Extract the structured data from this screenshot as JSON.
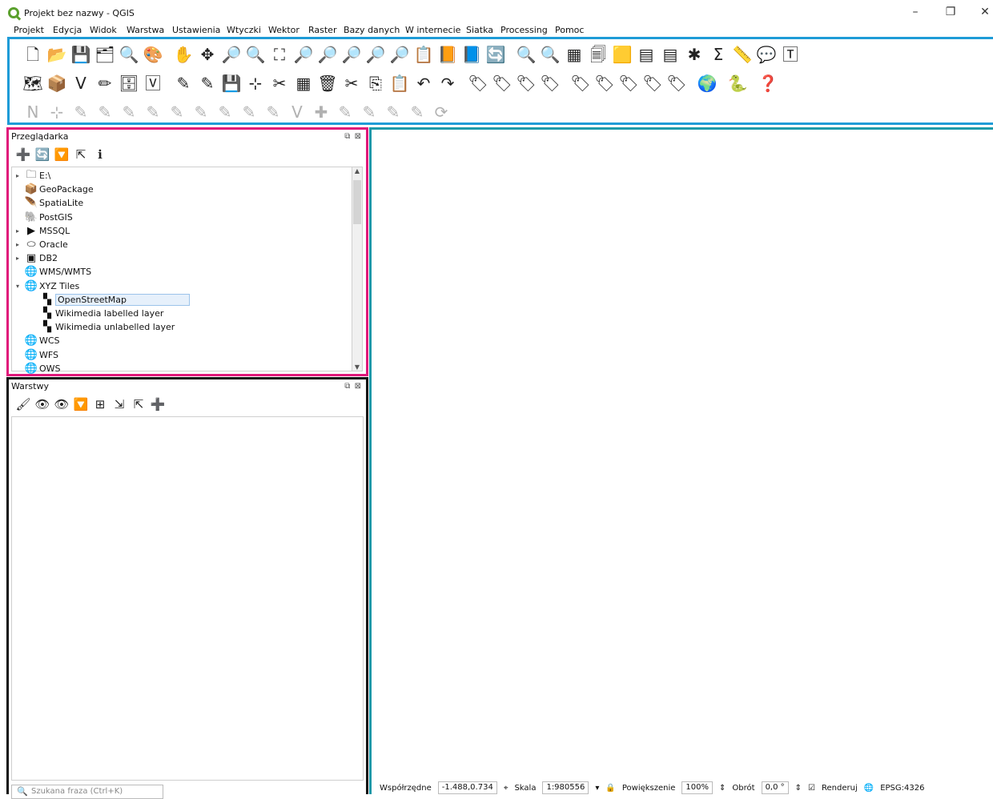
{
  "window": {
    "title": "Projekt bez nazwy - QGIS",
    "minimize": "–",
    "maximize": "❐",
    "close": "✕"
  },
  "menu": [
    "Projekt",
    "Edycja",
    "Widok",
    "Warstwa",
    "Ustawienia",
    "Wtyczki",
    "Wektor",
    "Raster",
    "Bazy danych",
    "W internecie",
    "Siatka",
    "Processing",
    "Pomoc"
  ],
  "toolbars": {
    "row1": [
      "🗋",
      "📂",
      "💾",
      "🗂",
      "🔍",
      "🎨",
      "|",
      "✋",
      "✥",
      "🔎",
      "🔍",
      "⛶",
      "🔎",
      "🔎",
      "🔎",
      "🔎",
      "🔎",
      "📋",
      "📙",
      "📘",
      "🔄",
      "|",
      "🔍",
      "🔍",
      "▦",
      "🗐",
      "🟨",
      "▤",
      "▤",
      "✱",
      "Σ",
      "📏",
      "💬",
      "🅃"
    ],
    "row2": [
      "🗺",
      "📦",
      "V",
      "✏",
      "🗄",
      "🅅",
      "|",
      "✎",
      "✎",
      "💾",
      "⊹",
      "✂",
      "▦",
      "🗑",
      "✂",
      "⎘",
      "📋",
      "↶",
      "↷",
      "|",
      "🏷",
      "🏷",
      "🏷",
      "🏷",
      "|",
      "🏷",
      "🏷",
      "🏷",
      "🏷",
      "🏷",
      "|",
      "🌍",
      "|",
      "🐍",
      "|",
      "❓"
    ],
    "row3": [
      "N",
      "⊹",
      "✎",
      "✎",
      "✎",
      "✎",
      "✎",
      "✎",
      "✎",
      "✎",
      "✎",
      "V",
      "✚",
      "✎",
      "✎",
      "✎",
      "✎",
      "⟳"
    ]
  },
  "browser": {
    "title": "Przeglądarka",
    "buttons": "⧉ ⊠",
    "tools": [
      "➕",
      "🔄",
      "🔽",
      "⇱",
      "ℹ"
    ],
    "items": [
      {
        "expander": "▸",
        "icon": "🗀",
        "label": "E:\\"
      },
      {
        "expander": "",
        "icon": "📦",
        "label": "GeoPackage"
      },
      {
        "expander": "",
        "icon": "🪶",
        "label": "SpatiaLite"
      },
      {
        "expander": "",
        "icon": "🐘",
        "label": "PostGIS"
      },
      {
        "expander": "▸",
        "icon": "▶",
        "label": "MSSQL"
      },
      {
        "expander": "▸",
        "icon": "⬭",
        "label": "Oracle"
      },
      {
        "expander": "▸",
        "icon": "▣",
        "label": "DB2"
      },
      {
        "expander": "",
        "icon": "🌐",
        "label": "WMS/WMTS"
      },
      {
        "expander": "▾",
        "icon": "🌐",
        "label": "XYZ Tiles"
      },
      {
        "expander": "",
        "icon": "▚",
        "label": "OpenStreetMap",
        "indent": 1,
        "selected": true
      },
      {
        "expander": "",
        "icon": "▚",
        "label": "Wikimedia labelled layer",
        "indent": 1
      },
      {
        "expander": "",
        "icon": "▚",
        "label": "Wikimedia unlabelled layer",
        "indent": 1
      },
      {
        "expander": "",
        "icon": "🌐",
        "label": "WCS"
      },
      {
        "expander": "",
        "icon": "🌐",
        "label": "WFS"
      },
      {
        "expander": "",
        "icon": "🌐",
        "label": "OWS"
      }
    ]
  },
  "layers": {
    "title": "Warstwy",
    "buttons": "⧉ ⊠",
    "tools": [
      "🖌",
      "👁",
      "👁",
      "🔽",
      "⊞",
      "⇲",
      "⇱",
      "➕"
    ],
    "search_placeholder": "Szukana fraza (Ctrl+K)"
  },
  "statusbar": {
    "coords_label": "Współrzędne",
    "coords_value": "-1.488,0.734",
    "scale_label": "Skala",
    "scale_value": "1:980556",
    "magnifier_label": "Powiększenie",
    "magnifier_value": "100%",
    "rotation_label": "Obrót",
    "rotation_value": "0,0 °",
    "render_label": "Renderuj",
    "crs": "EPSG:4326"
  }
}
